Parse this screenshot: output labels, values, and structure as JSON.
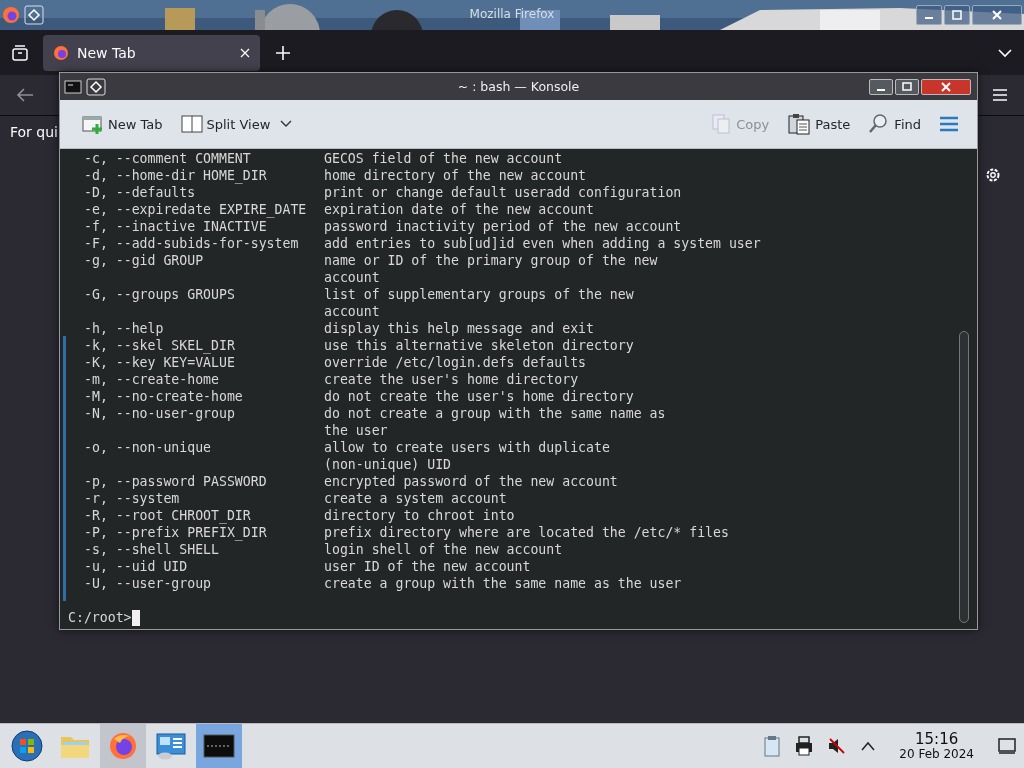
{
  "firefox": {
    "title": "Mozilla Firefox",
    "tabs": [
      {
        "label": "New Tab",
        "selected": true
      }
    ],
    "content_text": "For qui"
  },
  "konsole": {
    "title": "~ : bash — Konsole",
    "toolbar_left": [
      {
        "label": "New Tab",
        "kind": "new-tab",
        "disabled": false
      },
      {
        "label": "Split View",
        "kind": "split-view",
        "disabled": false
      }
    ],
    "toolbar_right": [
      {
        "label": "Copy",
        "kind": "copy",
        "disabled": true
      },
      {
        "label": "Paste",
        "kind": "paste",
        "disabled": false
      },
      {
        "label": "Find",
        "kind": "find",
        "disabled": false
      }
    ],
    "lines": [
      {
        "option": "-c, --comment COMMENT",
        "description": "GECOS field of the new account"
      },
      {
        "option": "-d, --home-dir HOME_DIR",
        "description": "home directory of the new account"
      },
      {
        "option": "-D, --defaults",
        "description": "print or change default useradd configuration"
      },
      {
        "option": "-e, --expiredate EXPIRE_DATE",
        "description": "expiration date of the new account"
      },
      {
        "option": "-f, --inactive INACTIVE",
        "description": "password inactivity period of the new account"
      },
      {
        "option": "-F, --add-subids-for-system",
        "description": "add entries to sub[ud]id even when adding a system user"
      },
      {
        "option": "-g, --gid GROUP",
        "description": "name or ID of the primary group of the new"
      },
      {
        "description": "account"
      },
      {
        "option": "-G, --groups GROUPS",
        "description": "list of supplementary groups of the new"
      },
      {
        "description": "account"
      },
      {
        "option": "-h, --help",
        "description": "display this help message and exit"
      },
      {
        "option": "-k, --skel SKEL_DIR",
        "description": "use this alternative skeleton directory"
      },
      {
        "option": "-K, --key KEY=VALUE",
        "description": "override /etc/login.defs defaults"
      },
      {
        "option": "-m, --create-home",
        "description": "create the user's home directory"
      },
      {
        "option": "-M, --no-create-home",
        "description": "do not create the user's home directory"
      },
      {
        "option": "-N, --no-user-group",
        "description": "do not create a group with the same name as"
      },
      {
        "description": "the user"
      },
      {
        "option": "-o, --non-unique",
        "description": "allow to create users with duplicate"
      },
      {
        "description": "(non-unique) UID"
      },
      {
        "option": "-p, --password PASSWORD",
        "description": "encrypted password of the new account"
      },
      {
        "option": "-r, --system",
        "description": "create a system account"
      },
      {
        "option": "-R, --root CHROOT_DIR",
        "description": "directory to chroot into"
      },
      {
        "option": "-P, --prefix PREFIX_DIR",
        "description": "prefix directory where are located the /etc/* files"
      },
      {
        "option": "-s, --shell SHELL",
        "description": "login shell of the new account"
      },
      {
        "option": "-u, --uid UID",
        "description": "user ID of the new account"
      },
      {
        "option": "-U, --user-group",
        "description": "create a group with the same name as the user"
      }
    ],
    "prompt": "C:/root>"
  },
  "taskbar": {
    "apps": [
      {
        "kind": "start",
        "running": false,
        "selected": false
      },
      {
        "kind": "folder",
        "running": false,
        "selected": false
      },
      {
        "kind": "browser",
        "running": true,
        "selected": false
      },
      {
        "kind": "computer",
        "running": false,
        "selected": false
      },
      {
        "kind": "terminal",
        "running": true,
        "selected": true
      }
    ],
    "time": "15:16",
    "date": "20 Feb 2024"
  }
}
